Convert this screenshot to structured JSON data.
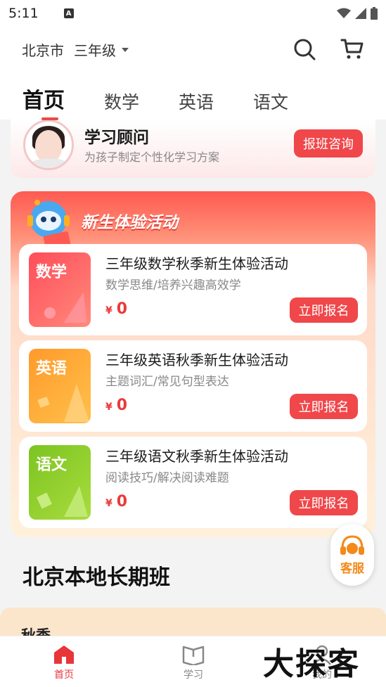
{
  "status": {
    "time": "5:11",
    "a_badge": "A"
  },
  "header": {
    "city": "北京市",
    "grade": "三年级",
    "tabs": [
      {
        "label": "首页",
        "active": true
      },
      {
        "label": "数学",
        "active": false
      },
      {
        "label": "英语",
        "active": false
      },
      {
        "label": "语文",
        "active": false
      }
    ]
  },
  "consultant": {
    "title": "学习顾问",
    "subtitle": "为孩子制定个性化学习方案",
    "button": "报班咨询"
  },
  "activity": {
    "title": "新生体验活动",
    "courses": [
      {
        "tile": "数学",
        "title": "三年级数学秋季新生体验活动",
        "sub": "数学思维/培养兴趣高效学",
        "currency": "¥",
        "price": "0",
        "button": "立即报名",
        "color_a": "#ff4d5a",
        "color_b": "#ff8a7a"
      },
      {
        "tile": "英语",
        "title": "三年级英语秋季新生体验活动",
        "sub": "主题词汇/常见句型表达",
        "currency": "¥",
        "price": "0",
        "button": "立即报名",
        "color_a": "#ff9a2b",
        "color_b": "#ffc04a"
      },
      {
        "tile": "语文",
        "title": "三年级语文秋季新生体验活动",
        "sub": "阅读技巧/解决阅读难题",
        "currency": "¥",
        "price": "0",
        "button": "立即报名",
        "color_a": "#7cc421",
        "color_b": "#a9dc3e"
      }
    ]
  },
  "customer_service": {
    "label": "客服"
  },
  "section": {
    "title": "北京本地长期班"
  },
  "autumn": {
    "label": "秋季"
  },
  "bottom_nav": [
    {
      "label": "首页",
      "active": true
    },
    {
      "label": "学习",
      "active": false
    },
    {
      "label": "我的",
      "active": false
    }
  ],
  "watermark": "大探客",
  "colors": {
    "accent": "#f0474a",
    "price": "#ea3b3b",
    "cs": "#f38a1a"
  }
}
